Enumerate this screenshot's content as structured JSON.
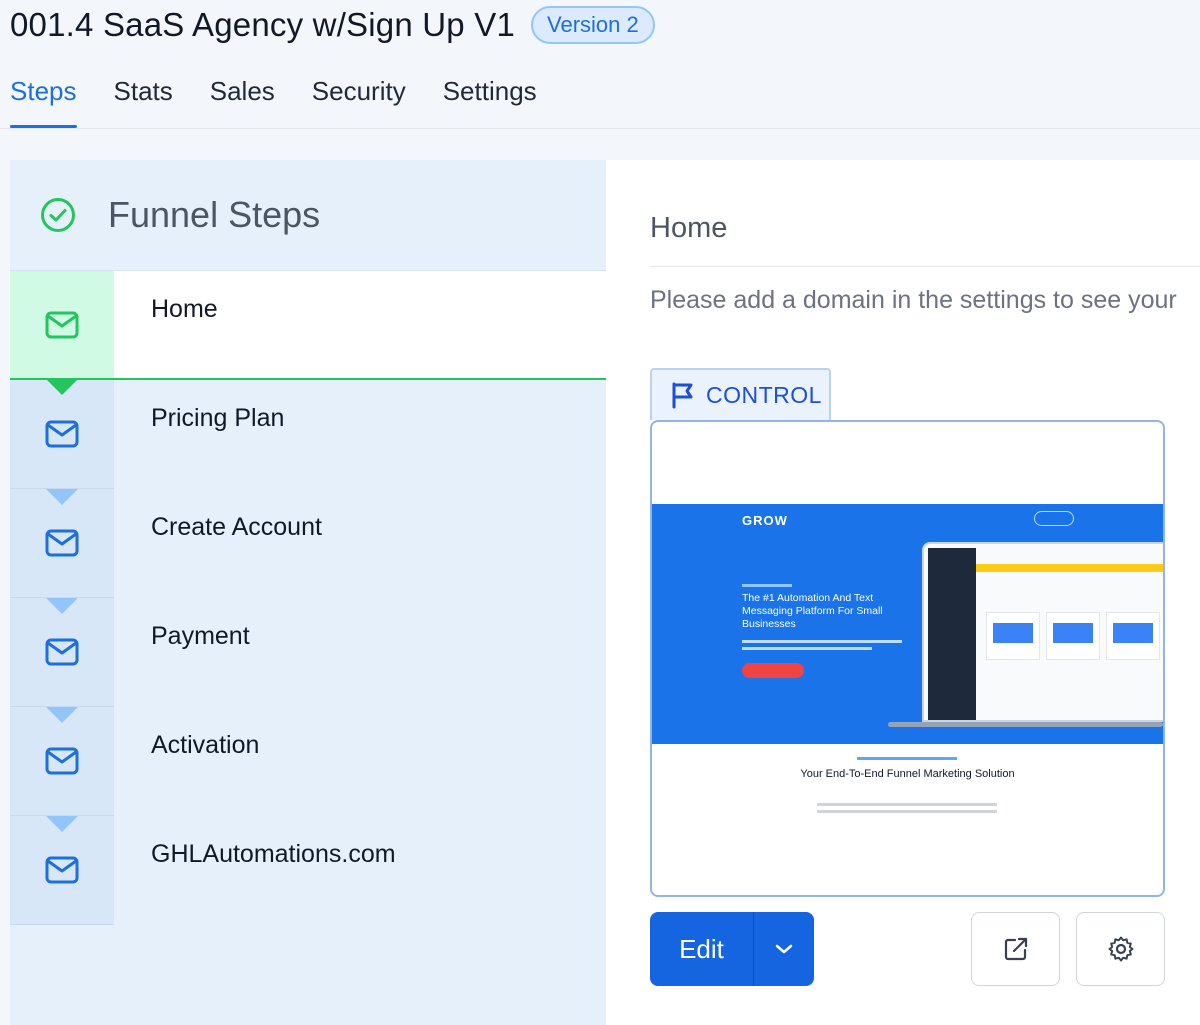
{
  "header": {
    "title": "001.4 SaaS Agency w/Sign Up V1",
    "version_badge": "Version 2",
    "tabs": [
      {
        "label": "Steps",
        "active": true
      },
      {
        "label": "Stats",
        "active": false
      },
      {
        "label": "Sales",
        "active": false
      },
      {
        "label": "Security",
        "active": false
      },
      {
        "label": "Settings",
        "active": false
      }
    ]
  },
  "funnel": {
    "title": "Funnel Steps",
    "icon": "check-circle-icon",
    "steps": [
      {
        "label": "Home",
        "icon": "mail-icon",
        "active": true
      },
      {
        "label": "Pricing Plan",
        "icon": "mail-icon",
        "active": false
      },
      {
        "label": "Create Account",
        "icon": "mail-icon",
        "active": false
      },
      {
        "label": "Payment",
        "icon": "mail-icon",
        "active": false
      },
      {
        "label": "Activation",
        "icon": "mail-icon",
        "active": false
      },
      {
        "label": "GHLAutomations.com",
        "icon": "mail-icon",
        "active": false
      }
    ]
  },
  "detail": {
    "title": "Home",
    "notice": "Please add a domain in the settings to see your",
    "variant_label": "CONTROL",
    "preview": {
      "logo": "GROW",
      "headline": "The #1 Automation And Text Messaging Platform For Small Businesses",
      "section_title": "Your End-To-End Funnel Marketing Solution"
    },
    "edit_label": "Edit"
  },
  "colors": {
    "accent": "#1d6fdc",
    "success": "#22c55e",
    "primary_button": "#1565e0",
    "panel_bg": "#e6f0fb"
  }
}
